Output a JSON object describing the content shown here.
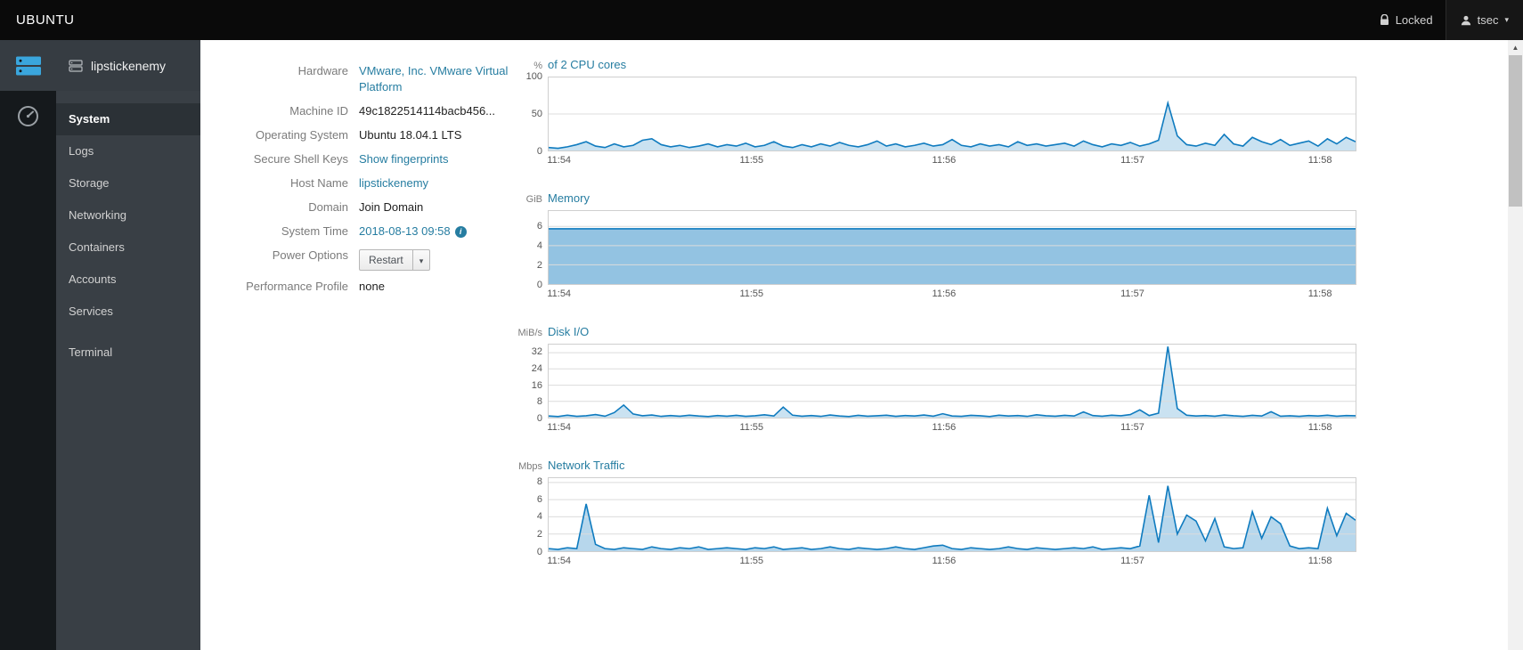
{
  "topbar": {
    "brand": "UBUNTU",
    "locked_label": "Locked",
    "user_label": "tsec"
  },
  "sidebar": {
    "host": "lipstickenemy",
    "items": [
      {
        "label": "System"
      },
      {
        "label": "Logs"
      },
      {
        "label": "Storage"
      },
      {
        "label": "Networking"
      },
      {
        "label": "Containers"
      },
      {
        "label": "Accounts"
      },
      {
        "label": "Services"
      },
      {
        "label": "Terminal"
      }
    ]
  },
  "system_info": {
    "rows": [
      {
        "label": "Hardware",
        "value": "VMware, Inc. VMware Virtual Platform"
      },
      {
        "label": "Machine ID",
        "value": "49c1822514114bacb456..."
      },
      {
        "label": "Operating System",
        "value": "Ubuntu 18.04.1 LTS"
      },
      {
        "label": "Secure Shell Keys",
        "value": "Show fingerprints"
      },
      {
        "label": "Host Name",
        "value": "lipstickenemy"
      },
      {
        "label": "Domain",
        "value": "Join Domain"
      },
      {
        "label": "System Time",
        "value": "2018-08-13 09:58"
      },
      {
        "label": "Power Options",
        "value": "Restart"
      },
      {
        "label": "Performance Profile",
        "value": "none"
      }
    ]
  },
  "icons": {
    "caret_down": "▾",
    "info": "i",
    "scroll_up": "▲"
  },
  "colors": {
    "accent": "#0f7bbf",
    "link": "#267da1",
    "topbar_bg": "#0a0a0a",
    "sidebar_bg": "#393f45"
  },
  "chart_data": [
    {
      "type": "line",
      "unit": "%",
      "title": "of 2 CPU cores",
      "ymax": 100,
      "yticks": [
        0,
        50,
        100
      ],
      "line_color": "#0f7bbf",
      "fill_opacity": 0.22,
      "xticks": [
        {
          "label": "11:54",
          "pos": 0.014
        },
        {
          "label": "11:55",
          "pos": 0.252
        },
        {
          "label": "11:56",
          "pos": 0.49
        },
        {
          "label": "11:57",
          "pos": 0.723
        },
        {
          "label": "11:58",
          "pos": 0.955
        }
      ],
      "values": [
        4,
        3,
        5,
        8,
        12,
        6,
        4,
        9,
        5,
        7,
        14,
        16,
        8,
        5,
        7,
        4,
        6,
        9,
        5,
        8,
        6,
        10,
        5,
        7,
        12,
        6,
        4,
        8,
        5,
        9,
        6,
        11,
        7,
        5,
        8,
        13,
        6,
        9,
        5,
        7,
        10,
        6,
        8,
        15,
        7,
        5,
        9,
        6,
        8,
        5,
        12,
        7,
        9,
        6,
        8,
        10,
        6,
        13,
        8,
        5,
        9,
        7,
        11,
        6,
        9,
        14,
        65,
        20,
        8,
        6,
        10,
        7,
        22,
        9,
        6,
        18,
        12,
        8,
        15,
        7,
        10,
        13,
        6,
        16,
        9,
        18,
        12
      ]
    },
    {
      "type": "area",
      "unit": "GiB",
      "title": "Memory",
      "ymax": 7.6,
      "yticks": [
        0,
        2,
        4,
        6
      ],
      "line_color": "#0f7bbf",
      "fill_opacity": 0.45,
      "xticks": [
        {
          "label": "11:54",
          "pos": 0.014
        },
        {
          "label": "11:55",
          "pos": 0.252
        },
        {
          "label": "11:56",
          "pos": 0.49
        },
        {
          "label": "11:57",
          "pos": 0.723
        },
        {
          "label": "11:58",
          "pos": 0.955
        }
      ],
      "values": [
        5.75,
        5.75,
        5.75,
        5.75,
        5.75,
        5.75,
        5.75,
        5.75
      ]
    },
    {
      "type": "line",
      "unit": "MiB/s",
      "title": "Disk I/O",
      "ymax": 36,
      "yticks": [
        0,
        8,
        16,
        24,
        32
      ],
      "line_color": "#0f7bbf",
      "fill_opacity": 0.22,
      "xticks": [
        {
          "label": "11:54",
          "pos": 0.014
        },
        {
          "label": "11:55",
          "pos": 0.252
        },
        {
          "label": "11:56",
          "pos": 0.49
        },
        {
          "label": "11:57",
          "pos": 0.723
        },
        {
          "label": "11:58",
          "pos": 0.955
        }
      ],
      "values": [
        0.8,
        0.5,
        1.2,
        0.6,
        0.9,
        1.5,
        0.7,
        2.5,
        6.2,
        1.8,
        0.9,
        1.3,
        0.6,
        1.0,
        0.7,
        1.2,
        0.8,
        0.5,
        1.0,
        0.7,
        1.1,
        0.6,
        0.9,
        1.4,
        0.8,
        5.2,
        1.2,
        0.7,
        1.0,
        0.6,
        1.3,
        0.8,
        0.5,
        1.1,
        0.7,
        0.9,
        1.2,
        0.6,
        1.0,
        0.8,
        1.3,
        0.7,
        1.9,
        0.8,
        0.6,
        1.1,
        0.9,
        0.5,
        1.2,
        0.8,
        1.0,
        0.6,
        1.4,
        0.9,
        0.7,
        1.1,
        0.8,
        2.8,
        1.0,
        0.7,
        1.2,
        0.9,
        1.5,
        3.8,
        1.0,
        2.2,
        35,
        4.5,
        1.2,
        0.8,
        1.0,
        0.7,
        1.3,
        0.9,
        0.6,
        1.1,
        0.8,
        2.9,
        0.7,
        0.9,
        0.6,
        1.0,
        0.8,
        1.2,
        0.7,
        1.0,
        0.9
      ]
    },
    {
      "type": "line",
      "unit": "Mbps",
      "title": "Network Traffic",
      "ymax": 8.5,
      "yticks": [
        0,
        2,
        4,
        6,
        8
      ],
      "line_color": "#0f7bbf",
      "fill_opacity": 0.3,
      "xticks": [
        {
          "label": "11:54",
          "pos": 0.014
        },
        {
          "label": "11:55",
          "pos": 0.252
        },
        {
          "label": "11:56",
          "pos": 0.49
        },
        {
          "label": "11:57",
          "pos": 0.723
        },
        {
          "label": "11:58",
          "pos": 0.955
        }
      ],
      "values": [
        0.3,
        0.2,
        0.4,
        0.3,
        5.5,
        0.8,
        0.3,
        0.2,
        0.4,
        0.3,
        0.2,
        0.5,
        0.3,
        0.2,
        0.4,
        0.3,
        0.5,
        0.2,
        0.3,
        0.4,
        0.3,
        0.2,
        0.4,
        0.3,
        0.5,
        0.2,
        0.3,
        0.4,
        0.2,
        0.3,
        0.5,
        0.3,
        0.2,
        0.4,
        0.3,
        0.2,
        0.3,
        0.5,
        0.3,
        0.2,
        0.4,
        0.6,
        0.7,
        0.3,
        0.2,
        0.4,
        0.3,
        0.2,
        0.3,
        0.5,
        0.3,
        0.2,
        0.4,
        0.3,
        0.2,
        0.3,
        0.4,
        0.3,
        0.5,
        0.2,
        0.3,
        0.4,
        0.3,
        0.6,
        6.5,
        1.0,
        7.6,
        2.0,
        4.2,
        3.5,
        1.2,
        3.8,
        0.5,
        0.3,
        0.4,
        4.6,
        1.5,
        4.0,
        3.2,
        0.6,
        0.3,
        0.4,
        0.3,
        5.0,
        1.8,
        4.4,
        3.6
      ]
    }
  ]
}
